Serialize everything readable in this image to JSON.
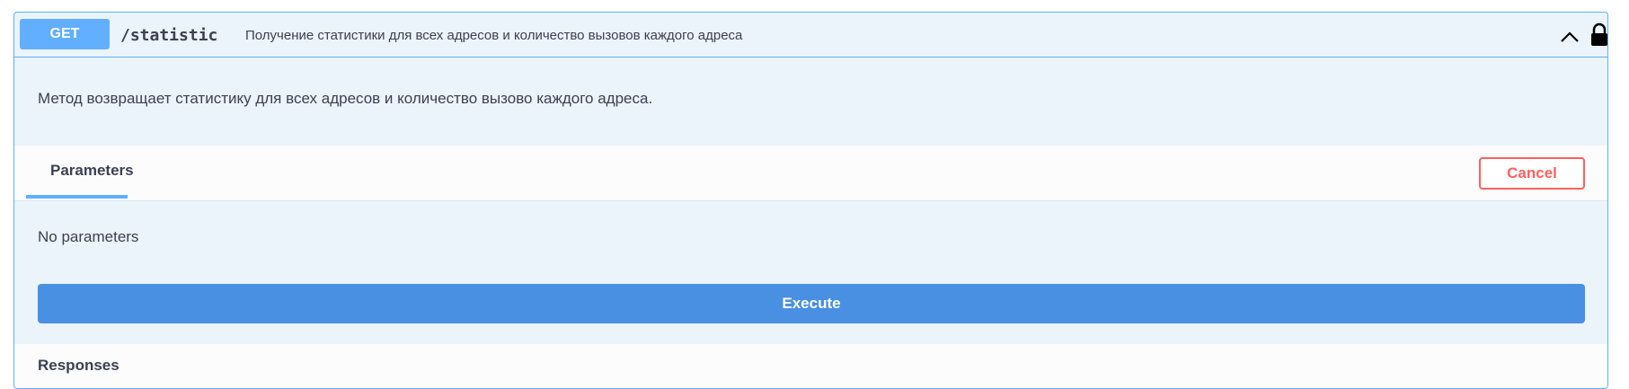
{
  "operation": {
    "method": "GET",
    "path": "/statistic",
    "summary": "Получение статистики для всех адресов и количество вызовов каждого адреса",
    "description": "Метод возвращает статистику для всех адресов и количество вызово каждого адреса.",
    "icons": {
      "collapse": "chevron-up-icon",
      "auth": "lock-icon"
    }
  },
  "parameters": {
    "tab_label": "Parameters",
    "cancel_label": "Cancel",
    "empty_text": "No parameters",
    "execute_label": "Execute"
  },
  "responses": {
    "title": "Responses"
  },
  "colors": {
    "accent": "#61affe",
    "execute": "#4990e2",
    "cancel": "#ff6060",
    "background": "#ebf3fb"
  }
}
